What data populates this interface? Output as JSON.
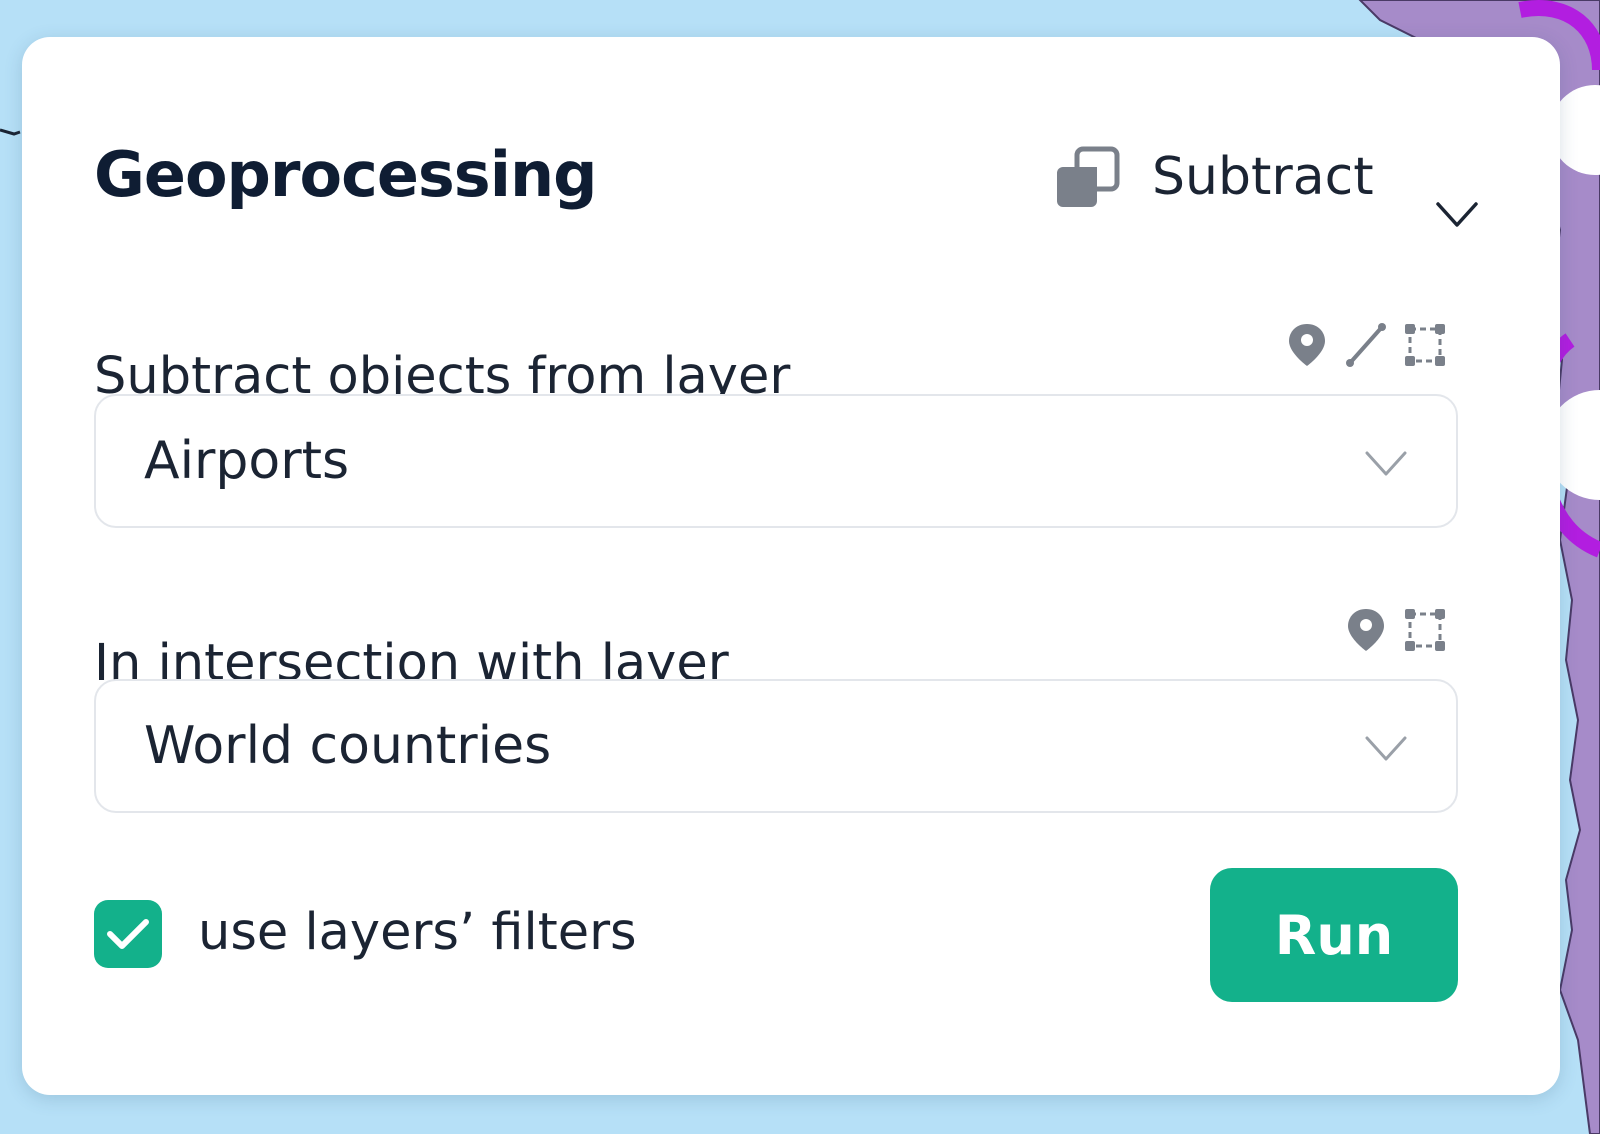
{
  "panel": {
    "title": "Geoprocessing",
    "operation": {
      "icon": "overlap-squares-icon",
      "selected": "Subtract"
    },
    "source_layer": {
      "label": "Subtract objects from layer",
      "value": "Airports",
      "geometry_icons": [
        "point-icon",
        "line-icon",
        "polygon-icon"
      ]
    },
    "overlay_layer": {
      "label": "In intersection with layer",
      "value": "World countries",
      "geometry_icons": [
        "point-icon",
        "polygon-icon"
      ]
    },
    "use_filters": {
      "label": "use layers’ filters",
      "checked": true
    },
    "run_label": "Run"
  },
  "colors": {
    "accent": "#13b18b",
    "text": "#1b2433",
    "title": "#0f1d33",
    "icon": "#7a808a",
    "map_water": "#b6e0f7",
    "map_land": "#a68bc9",
    "map_highlight": "#b21ee0"
  }
}
